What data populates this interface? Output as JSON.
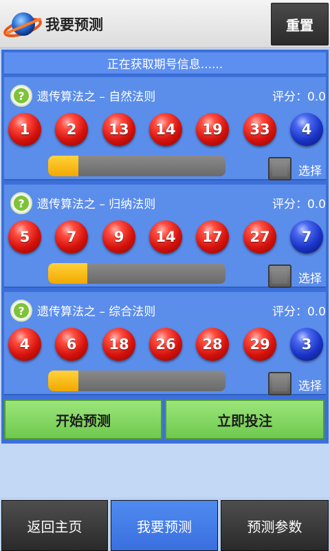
{
  "header": {
    "title": "我要预测",
    "reset_label": "重置",
    "logo_icon": "planet-ring-icon"
  },
  "info": {
    "status_text": "正在获取期号信息......"
  },
  "panels": [
    {
      "name": "遗传算法之 – 自然法则",
      "score": "评分：0.0",
      "red_balls": [
        "1",
        "2",
        "13",
        "14",
        "19",
        "33"
      ],
      "blue_ball": "4",
      "progress": 0.17,
      "checkbox_label": "选择",
      "checked": false
    },
    {
      "name": "遗传算法之 – 归纳法则",
      "score": "评分：0.0",
      "red_balls": [
        "5",
        "7",
        "9",
        "14",
        "17",
        "27"
      ],
      "blue_ball": "7",
      "progress": 0.22,
      "checkbox_label": "选择",
      "checked": false
    },
    {
      "name": "遗传算法之 – 综合法则",
      "score": "评分：0.0",
      "red_balls": [
        "4",
        "6",
        "18",
        "26",
        "28",
        "29"
      ],
      "blue_ball": "3",
      "progress": 0.17,
      "checkbox_label": "选择",
      "checked": false
    }
  ],
  "actions": {
    "start_label": "开始预测",
    "bet_label": "立即投注"
  },
  "bottom_nav": {
    "items": [
      {
        "label": "返回主页",
        "active": false
      },
      {
        "label": "我要预测",
        "active": true
      },
      {
        "label": "预测参数",
        "active": false
      }
    ]
  },
  "colors": {
    "main_blue": "#3d6fd9",
    "panel_blue": "#5b8deb",
    "progress_fill": "#ffc61a",
    "action_green": "#8bdc69",
    "nav_active": "#4a82ec"
  }
}
